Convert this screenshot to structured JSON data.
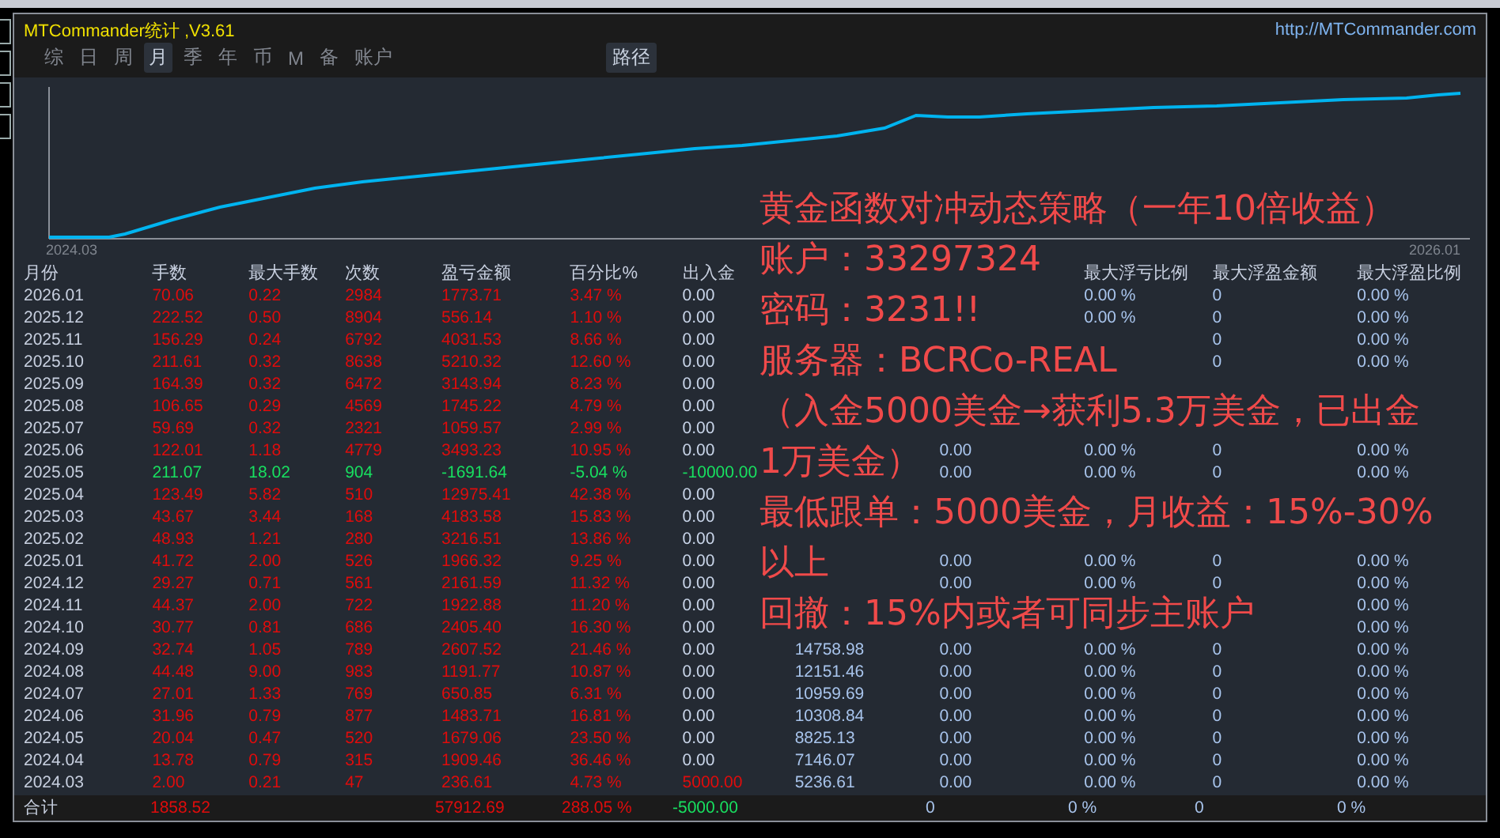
{
  "window": {
    "title": "MTCommander统计 ,V3.61",
    "url": "http://MTCommander.com"
  },
  "tabs": [
    {
      "label": "综",
      "selected": false
    },
    {
      "label": "日",
      "selected": false
    },
    {
      "label": "周",
      "selected": false
    },
    {
      "label": "月",
      "selected": true
    },
    {
      "label": "季",
      "selected": false
    },
    {
      "label": "年",
      "selected": false
    },
    {
      "label": "币",
      "selected": false
    },
    {
      "label": "M",
      "selected": false
    },
    {
      "label": "备",
      "selected": false
    },
    {
      "label": "账户",
      "selected": false
    }
  ],
  "path_button": "路径",
  "chart": {
    "start_label": "2024.03",
    "end_label": "2026.01"
  },
  "table": {
    "columns": [
      "月份",
      "手数",
      "最大手数",
      "次数",
      "盈亏金额",
      "百分比%",
      "出入金",
      null,
      null,
      "最大浮亏比例",
      "最大浮盈金额",
      "最大浮盈比例"
    ],
    "rows": [
      {
        "loss": false,
        "deposit": false,
        "withdrawal": false,
        "cells": [
          "2026.01",
          "70.06",
          "0.22",
          "2984",
          "1773.71",
          "3.47 %",
          "0.00",
          null,
          null,
          "0.00 %",
          "0",
          "0.00 %"
        ]
      },
      {
        "loss": false,
        "deposit": false,
        "withdrawal": false,
        "cells": [
          "2025.12",
          "222.52",
          "0.50",
          "8904",
          "556.14",
          "1.10 %",
          "0.00",
          null,
          null,
          "0.00 %",
          "0",
          "0.00 %"
        ]
      },
      {
        "loss": false,
        "deposit": false,
        "withdrawal": false,
        "cells": [
          "2025.11",
          "156.29",
          "0.24",
          "6792",
          "4031.53",
          "8.66 %",
          "0.00",
          null,
          null,
          null,
          "0",
          "0.00 %"
        ]
      },
      {
        "loss": false,
        "deposit": false,
        "withdrawal": false,
        "cells": [
          "2025.10",
          "211.61",
          "0.32",
          "8638",
          "5210.32",
          "12.60 %",
          "0.00",
          null,
          null,
          null,
          "0",
          "0.00 %"
        ]
      },
      {
        "loss": false,
        "deposit": false,
        "withdrawal": false,
        "cells": [
          "2025.09",
          "164.39",
          "0.32",
          "6472",
          "3143.94",
          "8.23 %",
          "0.00",
          null,
          null,
          null,
          null,
          null
        ]
      },
      {
        "loss": false,
        "deposit": false,
        "withdrawal": false,
        "cells": [
          "2025.08",
          "106.65",
          "0.29",
          "4569",
          "1745.22",
          "4.79 %",
          "0.00",
          null,
          null,
          null,
          null,
          null
        ]
      },
      {
        "loss": false,
        "deposit": false,
        "withdrawal": false,
        "cells": [
          "2025.07",
          "59.69",
          "0.32",
          "2321",
          "1059.57",
          "2.99 %",
          "0.00",
          null,
          null,
          null,
          null,
          null
        ]
      },
      {
        "loss": false,
        "deposit": false,
        "withdrawal": false,
        "cells": [
          "2025.06",
          "122.01",
          "1.18",
          "4779",
          "3493.23",
          "10.95 %",
          "0.00",
          null,
          "0.00",
          "0.00 %",
          "0",
          "0.00 %"
        ]
      },
      {
        "loss": true,
        "deposit": false,
        "withdrawal": true,
        "cells": [
          "2025.05",
          "211.07",
          "18.02",
          "904",
          "-1691.64",
          "-5.04 %",
          "-10000.00",
          null,
          "0.00",
          "0.00 %",
          "0",
          "0.00 %"
        ]
      },
      {
        "loss": false,
        "deposit": false,
        "withdrawal": false,
        "cells": [
          "2025.04",
          "123.49",
          "5.82",
          "510",
          "12975.41",
          "42.38 %",
          "0.00",
          null,
          null,
          null,
          null,
          null
        ]
      },
      {
        "loss": false,
        "deposit": false,
        "withdrawal": false,
        "cells": [
          "2025.03",
          "43.67",
          "3.44",
          "168",
          "4183.58",
          "15.83 %",
          "0.00",
          null,
          null,
          null,
          null,
          null
        ]
      },
      {
        "loss": false,
        "deposit": false,
        "withdrawal": false,
        "cells": [
          "2025.02",
          "48.93",
          "1.21",
          "280",
          "3216.51",
          "13.86 %",
          "0.00",
          null,
          null,
          null,
          null,
          null
        ]
      },
      {
        "loss": false,
        "deposit": false,
        "withdrawal": false,
        "cells": [
          "2025.01",
          "41.72",
          "2.00",
          "526",
          "1966.32",
          "9.25 %",
          "0.00",
          null,
          "0.00",
          "0.00 %",
          "0",
          "0.00 %"
        ]
      },
      {
        "loss": false,
        "deposit": false,
        "withdrawal": false,
        "cells": [
          "2024.12",
          "29.27",
          "0.71",
          "561",
          "2161.59",
          "11.32 %",
          "0.00",
          null,
          "0.00",
          "0.00 %",
          "0",
          "0.00 %"
        ]
      },
      {
        "loss": false,
        "deposit": false,
        "withdrawal": false,
        "cells": [
          "2024.11",
          "44.37",
          "2.00",
          "722",
          "1922.88",
          "11.20 %",
          "0.00",
          null,
          null,
          null,
          null,
          "0.00 %"
        ]
      },
      {
        "loss": false,
        "deposit": false,
        "withdrawal": false,
        "cells": [
          "2024.10",
          "30.77",
          "0.81",
          "686",
          "2405.40",
          "16.30 %",
          "0.00",
          null,
          null,
          null,
          null,
          "0.00 %"
        ]
      },
      {
        "loss": false,
        "deposit": false,
        "withdrawal": false,
        "cells": [
          "2024.09",
          "32.74",
          "1.05",
          "789",
          "2607.52",
          "21.46 %",
          "0.00",
          "14758.98",
          "0.00",
          "0.00 %",
          "0",
          "0.00 %"
        ]
      },
      {
        "loss": false,
        "deposit": false,
        "withdrawal": false,
        "cells": [
          "2024.08",
          "44.48",
          "9.00",
          "983",
          "1191.77",
          "10.87 %",
          "0.00",
          "12151.46",
          "0.00",
          "0.00 %",
          "0",
          "0.00 %"
        ]
      },
      {
        "loss": false,
        "deposit": false,
        "withdrawal": false,
        "cells": [
          "2024.07",
          "27.01",
          "1.33",
          "769",
          "650.85",
          "6.31 %",
          "0.00",
          "10959.69",
          "0.00",
          "0.00 %",
          "0",
          "0.00 %"
        ]
      },
      {
        "loss": false,
        "deposit": false,
        "withdrawal": false,
        "cells": [
          "2024.06",
          "31.96",
          "0.79",
          "877",
          "1483.71",
          "16.81 %",
          "0.00",
          "10308.84",
          "0.00",
          "0.00 %",
          "0",
          "0.00 %"
        ]
      },
      {
        "loss": false,
        "deposit": false,
        "withdrawal": false,
        "cells": [
          "2024.05",
          "20.04",
          "0.47",
          "520",
          "1679.06",
          "23.50 %",
          "0.00",
          "8825.13",
          "0.00",
          "0.00 %",
          "0",
          "0.00 %"
        ]
      },
      {
        "loss": false,
        "deposit": false,
        "withdrawal": false,
        "cells": [
          "2024.04",
          "13.78",
          "0.79",
          "315",
          "1909.46",
          "36.46 %",
          "0.00",
          "7146.07",
          "0.00",
          "0.00 %",
          "0",
          "0.00 %"
        ]
      },
      {
        "loss": false,
        "deposit": true,
        "withdrawal": false,
        "cells": [
          "2024.03",
          "2.00",
          "0.21",
          "47",
          "236.61",
          "4.73 %",
          "5000.00",
          "5236.61",
          "0.00",
          "0.00 %",
          "0",
          "0.00 %"
        ]
      }
    ],
    "total": {
      "loss": false,
      "deposit": false,
      "withdrawal": true,
      "cells": [
        "合计",
        "1858.52",
        null,
        null,
        "57912.69",
        "288.05 %",
        "-5000.00",
        null,
        "0",
        "0 %",
        "0",
        "0 %"
      ]
    }
  },
  "overlay": [
    "黄金函数对冲动态策略（一年10倍收益）",
    "账户：33297324",
    "密码：3231!!",
    "服务器：BCRCo-REAL",
    "（入金5000美金→获利5.3万美金，已出金",
    "1万美金）",
    "最低跟单：5000美金，月收益：15%-30%",
    "以上",
    "回撤：15%内或者可同步主账户"
  ]
}
